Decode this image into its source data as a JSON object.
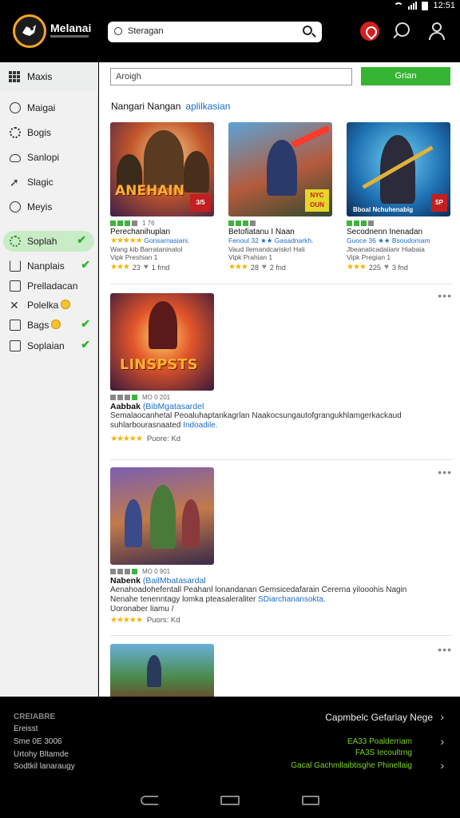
{
  "status": {
    "time": "12:51"
  },
  "app": {
    "title": "Melanai"
  },
  "search": {
    "placeholder": "Steragan"
  },
  "sidebar": {
    "header": "Maxis",
    "items": [
      {
        "label": "Maigai",
        "icon": "circle-icon",
        "check": ""
      },
      {
        "label": "Bogis",
        "icon": "gear-icon",
        "check": ""
      },
      {
        "label": "Sanlopi",
        "icon": "cloud-icon",
        "check": ""
      },
      {
        "label": "Slagic",
        "icon": "share-arrow-icon",
        "check": ""
      },
      {
        "label": "Meyis",
        "icon": "clock-icon",
        "check": ""
      },
      {
        "label": "Soplah",
        "icon": "settings-icon",
        "check": "✔",
        "active": true
      },
      {
        "label": "Nanplais",
        "icon": "edit-icon",
        "check": "✔"
      },
      {
        "label": "Prelladacan",
        "icon": "box-icon",
        "check": ""
      },
      {
        "label": "Polelka",
        "icon": "tools-icon",
        "check": ""
      },
      {
        "label": "Bags",
        "icon": "bag-icon",
        "check": "✔"
      },
      {
        "label": "Soplaian",
        "icon": "folder-icon",
        "check": "✔"
      }
    ]
  },
  "main": {
    "search_placeholder": "Aroigh",
    "button_label": "Grian",
    "section_title": "Nangari Nangan",
    "section_link": "aplilkasian",
    "cards": [
      {
        "thumb_text": "ANEHAIN",
        "badge": "3/5",
        "meta": "1 76",
        "title": "Perechanihuplan",
        "line1": "Gonsarnasiani.",
        "line2": "Wang kib Barrataninatol",
        "line3": "Vipk Preshian 1",
        "rating": "23",
        "likes": "1 fmd"
      },
      {
        "thumb_text": "",
        "badge": "NYC OUN",
        "meta": "",
        "title": "Betofiatanu I Naan",
        "line1": "Fenoul 32 ★★ Gasadnarkh.",
        "line2": "Vaud Ilemandcariskrl Hali",
        "line3": "Vipk Prahian 1",
        "rating": "28",
        "likes": "2 fnd"
      },
      {
        "thumb_text": "Bboal Nchuhenabig",
        "badge": "5P",
        "meta": "",
        "title": "Secodnenn Inenadan",
        "line1": "Guoce 36 ★★ Bsoudomam",
        "line2": "Jbeanaticadaiianr Hiabaia",
        "line3": "Vipk Pregian 1",
        "rating": "225",
        "likes": "3 fnd"
      }
    ],
    "rows": [
      {
        "thumb_text": "LINSPSTS",
        "meta": "MO 0 201",
        "title": "Aabbak",
        "title_link": "(BibMgatasardel",
        "desc1": "Semalaocanhetal Peoaluhaptankagrlan Naakocsungautofgrangukhlamgerkackaud",
        "desc2": "suhlarbourasnaated",
        "desc_link": "Indoadile.",
        "price": "Puore: Kd"
      },
      {
        "thumb_text": "",
        "meta": "MO 0 901",
        "title": "Nabenk",
        "title_link": "(BailMbatasardal",
        "desc1": "Aenahoadohefentall Peahanl lonandanan Gemsicedafarain Cererna yilooohis Nagin",
        "desc2": "Nenahe tenenntagy lomka pteasaleraliter",
        "desc_link": "SDiarchanansokta.",
        "desc3": "Uoronaber liamu /",
        "price": "Puors: Kd"
      },
      {
        "thumb_text": "",
        "meta": "",
        "title": "",
        "title_link": "",
        "desc1": "",
        "desc2": "",
        "desc_link": "",
        "price": ""
      }
    ]
  },
  "footer": {
    "left": [
      "CREIABRE",
      "Ereisst",
      "Sme 0E 3006",
      "Urtohy Bltamde",
      "Sodtkil lanaraugy"
    ],
    "right_title": "Capmbelc Gefariay Nege",
    "right_links": [
      "EA33 Poalderriam",
      "FA3S Iecoultrng",
      "Gacal Gachmllaibtisghe Phinellaig"
    ]
  },
  "colors": {
    "accent": "#35b533",
    "link": "#1a6dc9",
    "notification": "#d32020"
  }
}
